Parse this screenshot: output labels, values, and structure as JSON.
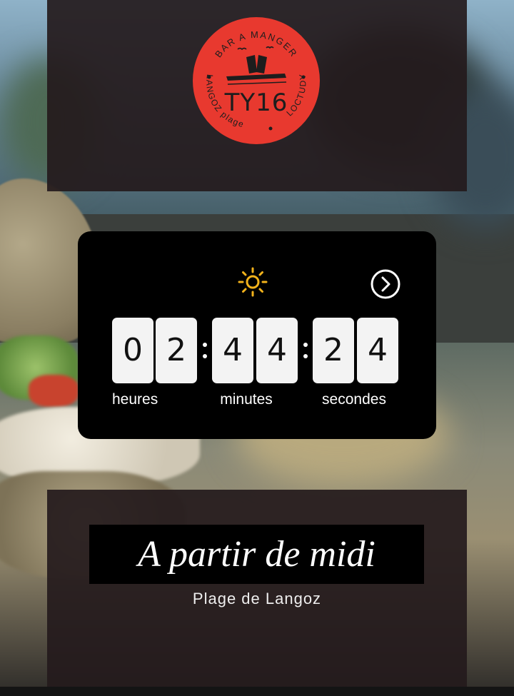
{
  "logo": {
    "top_text": "BAR A MANGER",
    "brand": "TY16",
    "left_text": "LANGOZ plage",
    "right_text": "LOCTUDY",
    "color": "#e8392f"
  },
  "countdown": {
    "hours": [
      "0",
      "2"
    ],
    "minutes": [
      "4",
      "4"
    ],
    "seconds": [
      "2",
      "4"
    ],
    "labels": {
      "hours": "heures",
      "minutes": "minutes",
      "seconds": "secondes"
    },
    "icons": {
      "weather": "sun-icon",
      "next": "chevron-right-circle-icon"
    },
    "accent": "#f2b21b"
  },
  "headline": "A partir de midi",
  "location": "Plage de Langoz"
}
